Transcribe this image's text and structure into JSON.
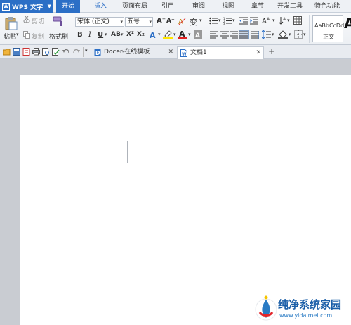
{
  "app": {
    "name": "WPS 文字",
    "logo_letter": "W"
  },
  "menu_tabs": [
    {
      "label": "开始"
    },
    {
      "label": "插入"
    },
    {
      "label": "页面布局"
    },
    {
      "label": "引用"
    },
    {
      "label": "审阅"
    },
    {
      "label": "视图"
    },
    {
      "label": "章节"
    },
    {
      "label": "开发工具"
    },
    {
      "label": "特色功能"
    }
  ],
  "ribbon": {
    "paste_label": "粘贴",
    "cut_label": "剪切",
    "copy_label": "复制",
    "format_painter_label": "格式刷",
    "font_name": "宋体 (正文)",
    "font_size": "五号",
    "grow_font": "A⁺",
    "shrink_font": "A⁻",
    "bold": "B",
    "italic": "I",
    "underline": "U",
    "strike": "AB",
    "superscript": "X²",
    "subscript": "X₂",
    "style_preview": "AaBbCcDd",
    "style_name": "正文",
    "style_preview_big": "A"
  },
  "doc_tabs": [
    {
      "label": "Docer-在线模板",
      "icon": "docer-icon"
    },
    {
      "label": "文档1",
      "icon": "document-icon"
    }
  ],
  "watermark": {
    "title": "纯净系统家园",
    "url": "www.yidaimei.com"
  },
  "colors": {
    "accent": "#2c6fc6",
    "docbg": "#c9ccd2",
    "page": "#ffffff"
  }
}
